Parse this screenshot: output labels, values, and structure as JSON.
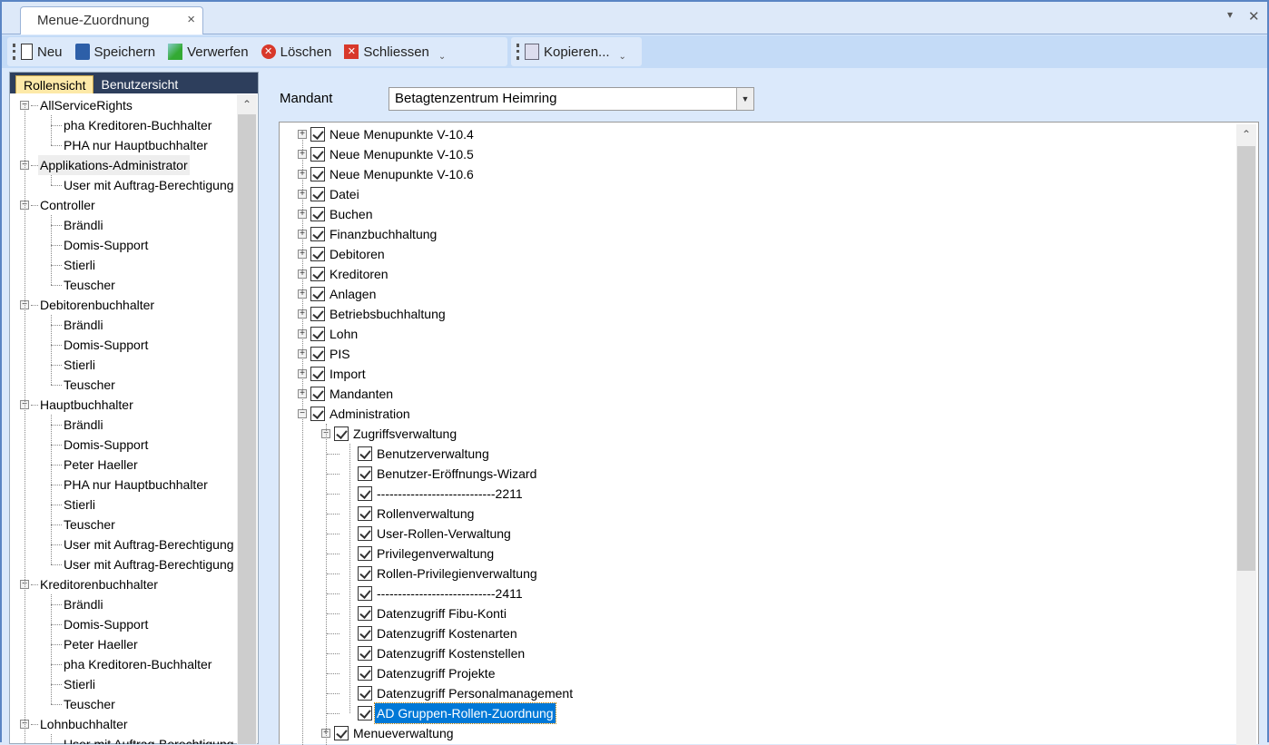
{
  "tab": {
    "title": "Menue-Zuordnung",
    "close": "×"
  },
  "window_buttons": {
    "menu": "▾",
    "close": "✕"
  },
  "toolbar": {
    "new": "Neu",
    "save": "Speichern",
    "discard": "Verwerfen",
    "delete": "Löschen",
    "close": "Schliessen",
    "copy": "Kopieren...",
    "overflow": "⌄"
  },
  "left": {
    "tabs": [
      "Rollensicht",
      "Benutzersicht"
    ],
    "tree": [
      {
        "label": "AllServiceRights",
        "children": [
          "pha Kreditoren-Buchhalter",
          "PHA nur Hauptbuchhalter"
        ]
      },
      {
        "label": "Applikations-Administrator",
        "highlighted": true,
        "children": [
          "User mit Auftrag-Berechtigung"
        ]
      },
      {
        "label": "Controller",
        "children": [
          "Brändli",
          "Domis-Support",
          "Stierli",
          "Teuscher"
        ]
      },
      {
        "label": "Debitorenbuchhalter",
        "children": [
          "Brändli",
          "Domis-Support",
          "Stierli",
          "Teuscher"
        ]
      },
      {
        "label": "Hauptbuchhalter",
        "children": [
          "Brändli",
          "Domis-Support",
          "Peter Haeller",
          "PHA nur Hauptbuchhalter",
          "Stierli",
          "Teuscher",
          "User mit Auftrag-Berechtigung",
          "User mit Auftrag-Berechtigung"
        ]
      },
      {
        "label": "Kreditorenbuchhalter",
        "children": [
          "Brändli",
          "Domis-Support",
          "Peter Haeller",
          "pha Kreditoren-Buchhalter",
          "Stierli",
          "Teuscher"
        ]
      },
      {
        "label": "Lohnbuchhalter",
        "children": [
          "User mit Auftrag-Berechtigung"
        ]
      }
    ]
  },
  "mandant": {
    "label": "Mandant",
    "value": "Betagtenzentrum Heimring"
  },
  "menu_tree": [
    {
      "label": "Neue Menupunkte V-10.4",
      "level": 0,
      "exp": "+"
    },
    {
      "label": "Neue Menupunkte V-10.5",
      "level": 0,
      "exp": "+"
    },
    {
      "label": "Neue Menupunkte V-10.6",
      "level": 0,
      "exp": "+"
    },
    {
      "label": "Datei",
      "level": 0,
      "exp": "+"
    },
    {
      "label": "Buchen",
      "level": 0,
      "exp": "+"
    },
    {
      "label": "Finanzbuchhaltung",
      "level": 0,
      "exp": "+"
    },
    {
      "label": "Debitoren",
      "level": 0,
      "exp": "+"
    },
    {
      "label": "Kreditoren",
      "level": 0,
      "exp": "+"
    },
    {
      "label": "Anlagen",
      "level": 0,
      "exp": "+"
    },
    {
      "label": "Betriebsbuchhaltung",
      "level": 0,
      "exp": "+"
    },
    {
      "label": "Lohn",
      "level": 0,
      "exp": "+"
    },
    {
      "label": "PIS",
      "level": 0,
      "exp": "+"
    },
    {
      "label": "Import",
      "level": 0,
      "exp": "+"
    },
    {
      "label": "Mandanten",
      "level": 0,
      "exp": "+"
    },
    {
      "label": "Administration",
      "level": 0,
      "exp": "−"
    },
    {
      "label": "Zugriffsverwaltung",
      "level": 1,
      "exp": "−"
    },
    {
      "label": "Benutzerverwaltung",
      "level": 2
    },
    {
      "label": "Benutzer-Eröffnungs-Wizard",
      "level": 2
    },
    {
      "label": "----------------------------2211",
      "level": 2
    },
    {
      "label": "Rollenverwaltung",
      "level": 2
    },
    {
      "label": "User-Rollen-Verwaltung",
      "level": 2
    },
    {
      "label": "Privilegenverwaltung",
      "level": 2
    },
    {
      "label": "Rollen-Privilegienverwaltung",
      "level": 2
    },
    {
      "label": "----------------------------2411",
      "level": 2
    },
    {
      "label": "Datenzugriff Fibu-Konti",
      "level": 2
    },
    {
      "label": "Datenzugriff Kostenarten",
      "level": 2
    },
    {
      "label": "Datenzugriff Kostenstellen",
      "level": 2
    },
    {
      "label": "Datenzugriff Projekte",
      "level": 2
    },
    {
      "label": "Datenzugriff Personalmanagement",
      "level": 2
    },
    {
      "label": "AD Gruppen-Rollen-Zuordnung",
      "level": 2,
      "selected": true
    },
    {
      "label": "Menueverwaltung",
      "level": 1,
      "exp": "+"
    }
  ]
}
